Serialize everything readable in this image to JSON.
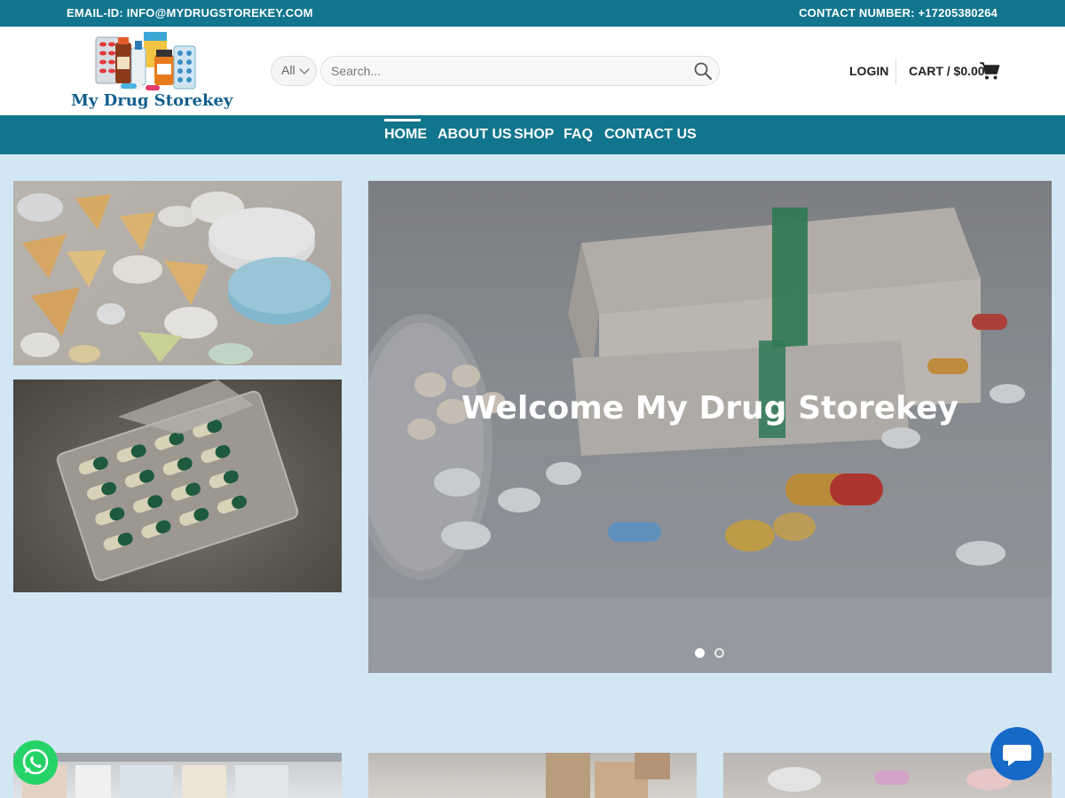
{
  "topbar": {
    "email": "EMAIL-ID: INFO@MYDRUGSTOREKEY.COM",
    "phone": "CONTACT NUMBER: +17205380264",
    "bg_color": "#11758d"
  },
  "header": {
    "logo_text": "My Drug Storekey",
    "category_select": "All",
    "search_placeholder": "Search...",
    "login_label": "LOGIN",
    "cart_label": "CART / $0.00"
  },
  "nav": {
    "items": [
      "HOME",
      "ABOUT US",
      "SHOP",
      "FAQ",
      "CONTACT US"
    ],
    "active": "HOME"
  },
  "slider": {
    "title": "Welcome My Drug Storekey",
    "slide_count": 2,
    "active_slide": 1
  },
  "icons": {
    "search": "search-icon",
    "cart": "cart-icon",
    "chevron": "chevron-down-icon",
    "whatsapp": "whatsapp-icon",
    "chat": "chat-icon"
  },
  "colors": {
    "brand": "#11758d",
    "page_bg": "#d2e6f3",
    "whatsapp": "#25d366",
    "chat": "#1769c7"
  }
}
